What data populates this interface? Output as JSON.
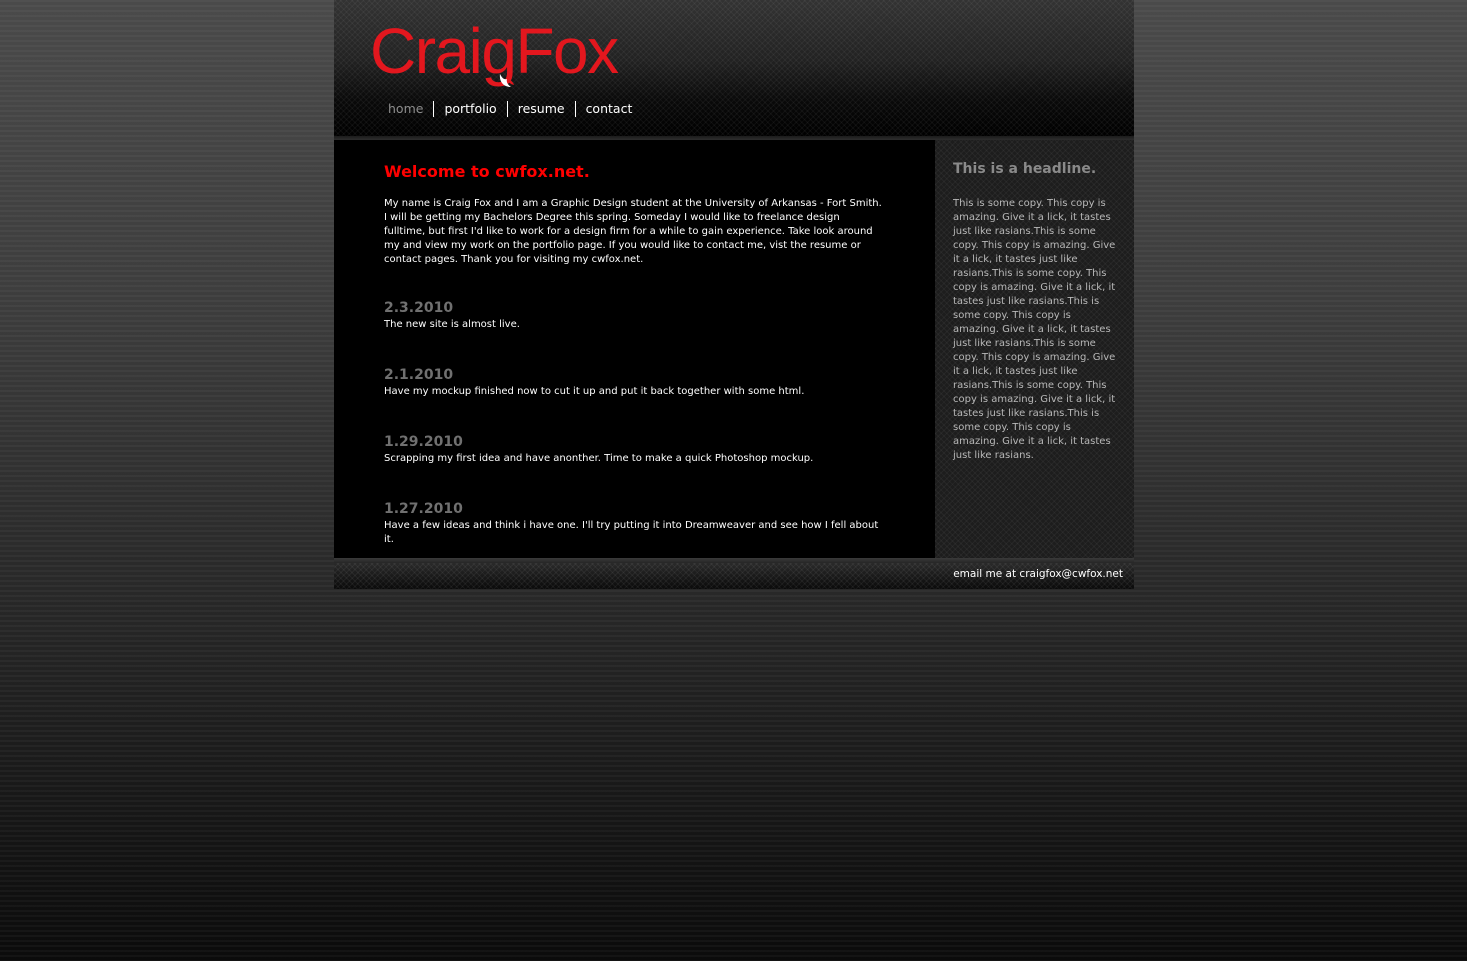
{
  "colors": {
    "logo_red": "#e3171e",
    "welcome_red": "#ff0000",
    "date_gray": "#707070",
    "nav_active": "#8d8d8d"
  },
  "header": {
    "logo_text": "CraigFox",
    "logo_icon": "fox-tail-icon",
    "nav": [
      {
        "label": "home",
        "active": true
      },
      {
        "label": "portfolio",
        "active": false
      },
      {
        "label": "resume",
        "active": false
      },
      {
        "label": "contact",
        "active": false
      }
    ]
  },
  "main": {
    "title": "Welcome to cwfox.net.",
    "intro": "My name is Craig Fox and I am a Graphic Design student at the University of Arkansas - Fort Smith. I will be getting my Bachelors Degree this spring. Someday I would like to freelance design fulltime, but first I'd like to work for a design firm for a while to gain experience. Take look around my and view my work on the portfolio page. If you would like to contact me, vist the resume or contact pages. Thank you for visiting my cwfox.net.",
    "news": [
      {
        "date": "2.3.2010",
        "text": "The new site is almost live."
      },
      {
        "date": "2.1.2010",
        "text": "Have my mockup finished now to cut it up and put it back together with some html."
      },
      {
        "date": "1.29.2010",
        "text": "Scrapping my first idea and have anonther. Time to make a quick Photoshop mockup."
      },
      {
        "date": "1.27.2010",
        "text": "Have a few ideas and think i have one. I'll try putting it into Dreamweaver and see how I fell about it."
      }
    ]
  },
  "sidebar": {
    "headline": "This is a headline.",
    "copy": "This is some copy. This copy is amazing. Give it a lick, it tastes just like rasians.This is some copy. This copy is amazing. Give it a lick, it tastes just like rasians.This is some copy. This copy is amazing. Give it a lick, it tastes just like rasians.This is some copy. This copy is amazing. Give it a lick, it tastes just like rasians.This is some copy. This copy is amazing. Give it a lick, it tastes just like rasians.This is some copy. This copy is amazing. Give it a lick, it tastes just like rasians.This is some copy. This copy is amazing. Give it a lick, it tastes just like rasians."
  },
  "footer": {
    "email_text": "email me at craigfox@cwfox.net"
  }
}
